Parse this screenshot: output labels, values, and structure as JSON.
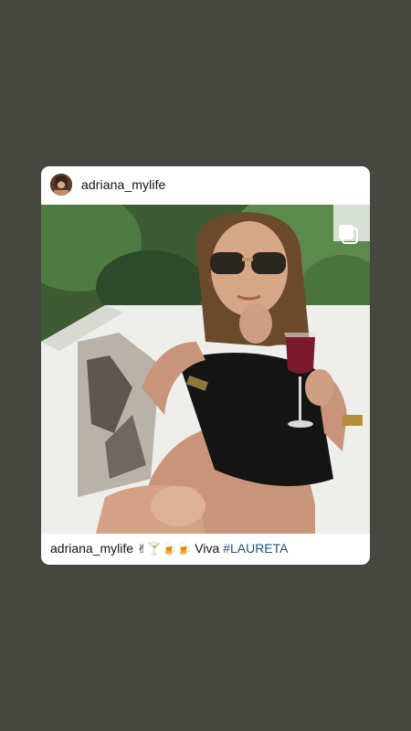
{
  "post": {
    "username": "adriana_mylife",
    "photo_description": "",
    "caption": {
      "username": "adriana_mylife",
      "emojis": "✌🍸🍺🍺",
      "text": "Viva",
      "hashtag": "#LAURETA"
    },
    "icons": {
      "avatar": "avatar-photo",
      "multi_image": "multiple-images-icon"
    }
  },
  "colors": {
    "background": "#474741",
    "card": "#ffffff",
    "hashtag": "#1d4f78"
  }
}
